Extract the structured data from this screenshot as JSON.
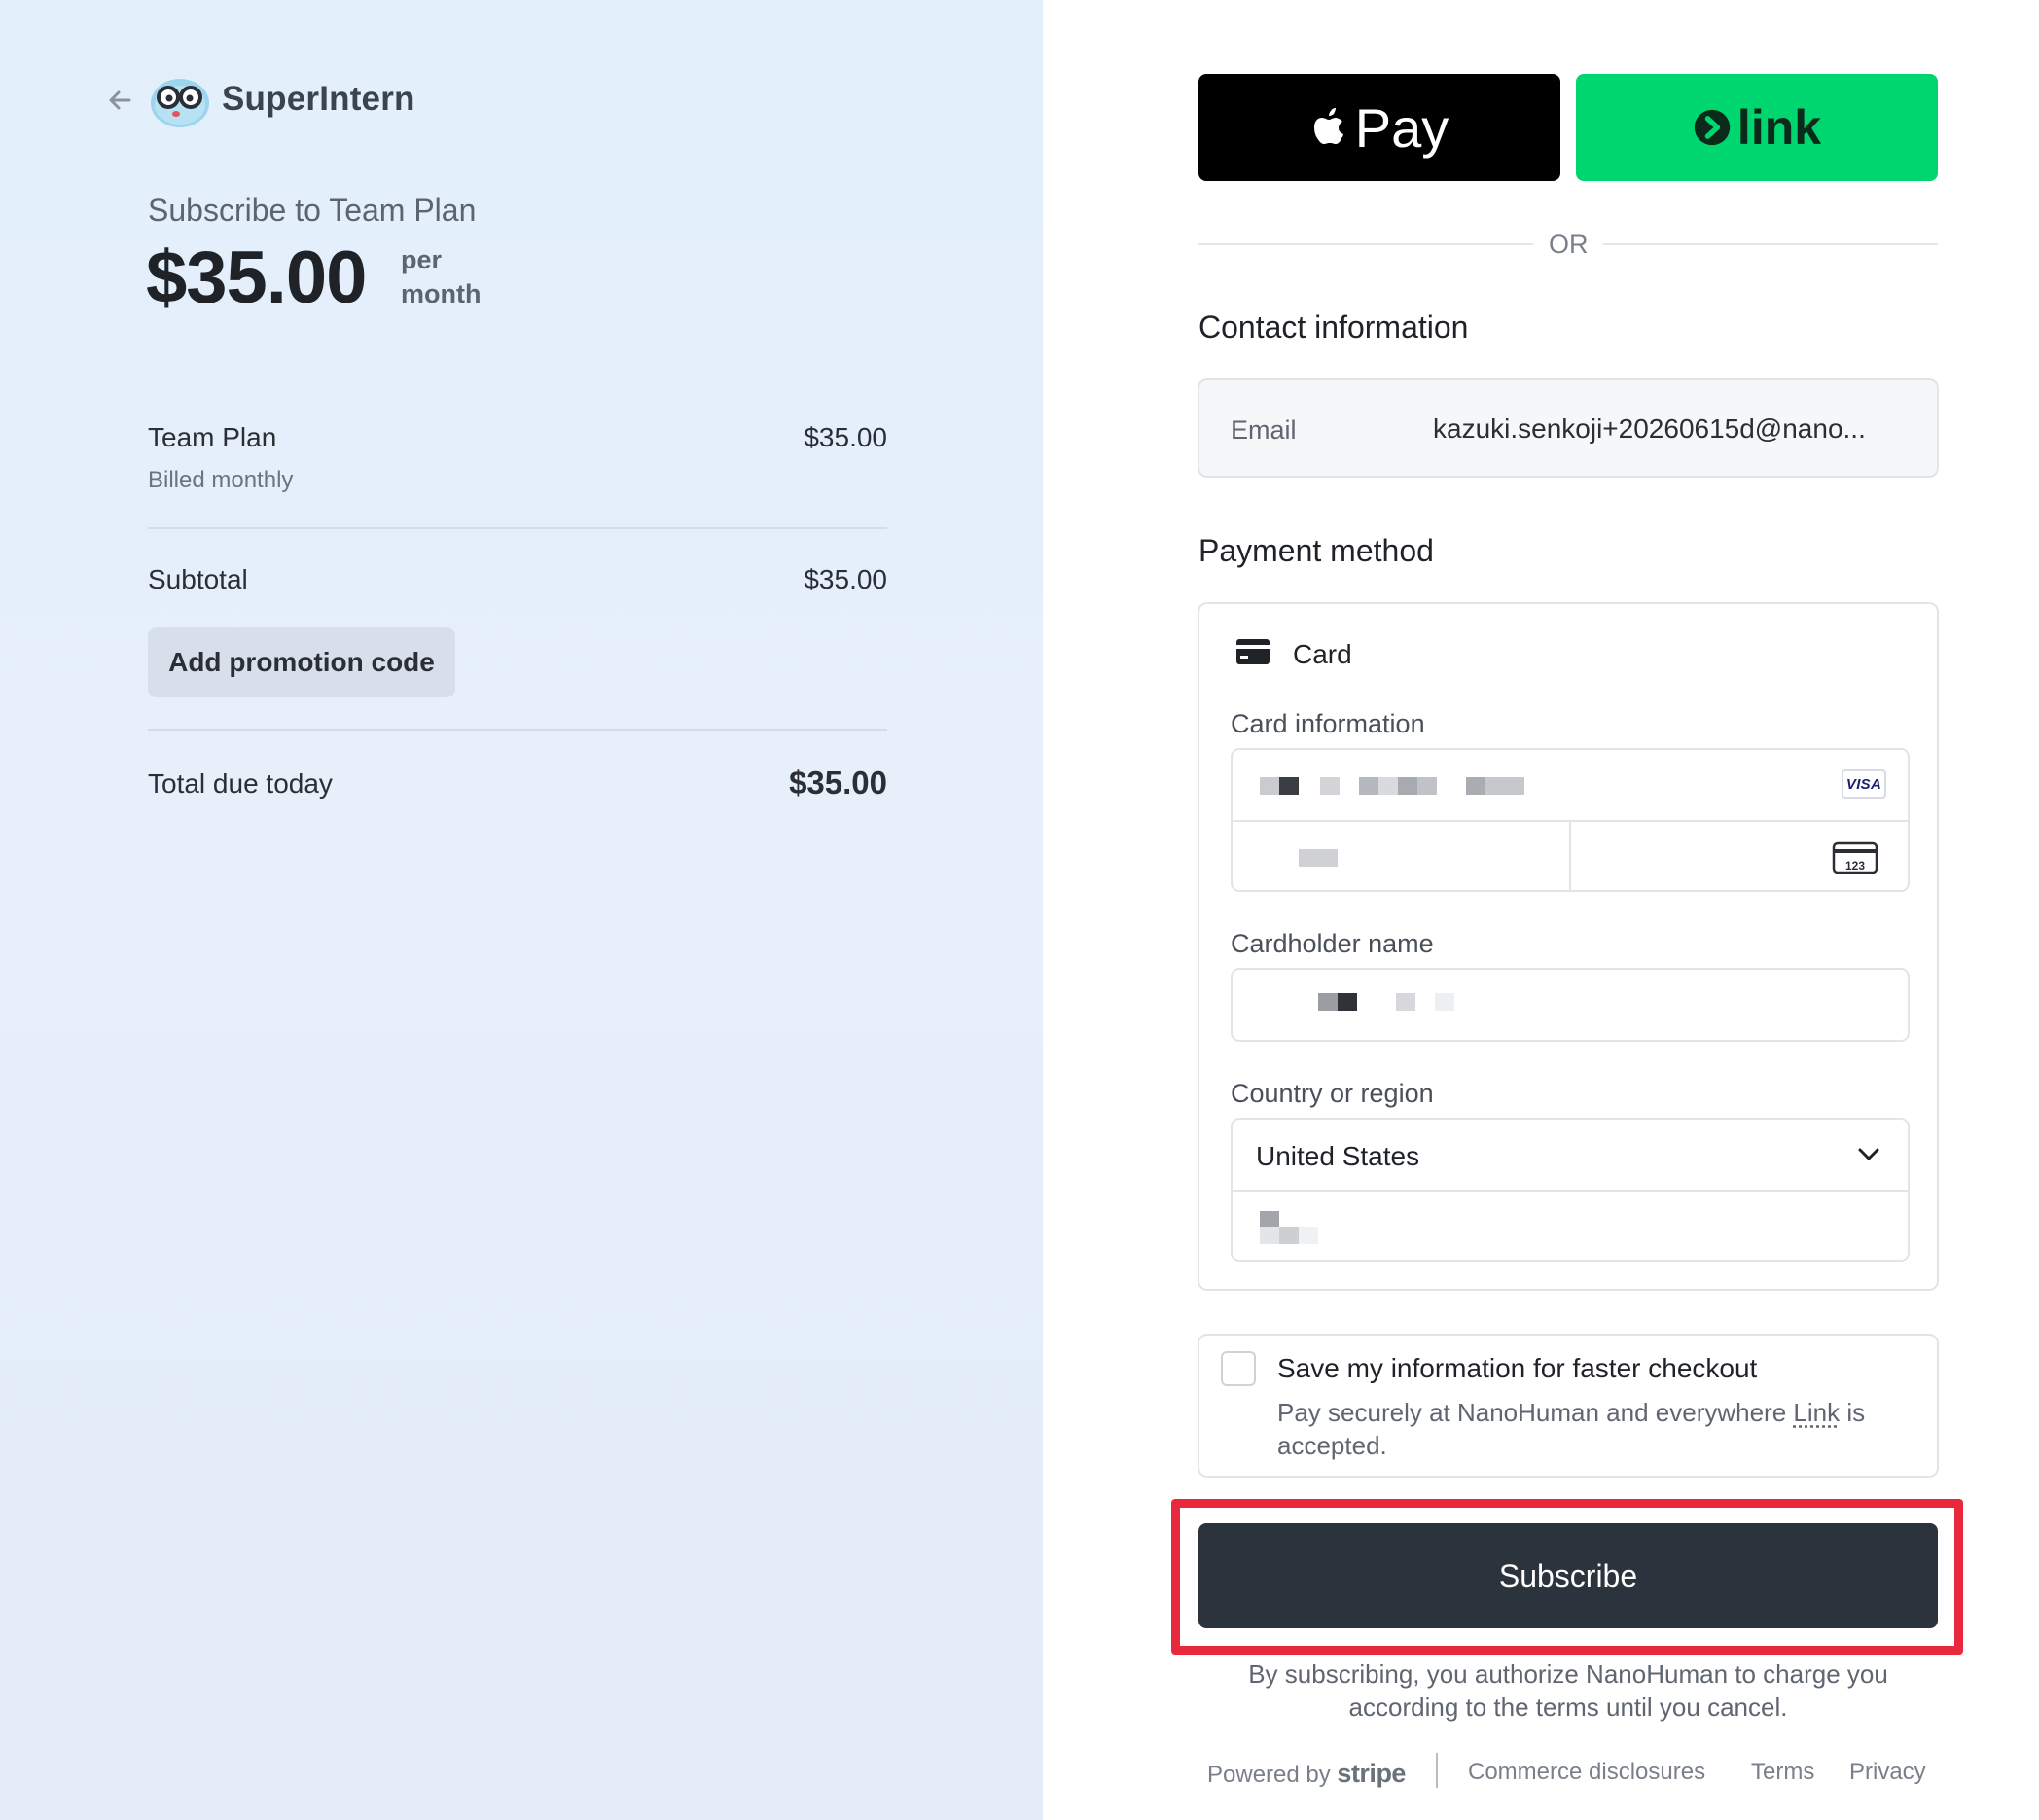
{
  "brand": {
    "name": "SuperIntern"
  },
  "summary": {
    "title": "Subscribe to Team Plan",
    "price": "$35.00",
    "per_line1": "per",
    "per_line2": "month",
    "item_name": "Team Plan",
    "item_billing": "Billed monthly",
    "item_price": "$35.00",
    "subtotal_label": "Subtotal",
    "subtotal_value": "$35.00",
    "promo_label": "Add promotion code",
    "total_label": "Total due today",
    "total_value": "$35.00"
  },
  "express": {
    "apple_pay_label": "Pay",
    "link_label": "link",
    "or_label": "OR"
  },
  "contact": {
    "title": "Contact information",
    "email_label": "Email",
    "email_value": "kazuki.senkoji+20260615d@nano..."
  },
  "payment": {
    "title": "Payment method",
    "method_label": "Card",
    "card_info_label": "Card information",
    "card_brand": "VISA",
    "cvc_icon_text": "123",
    "cardholder_label": "Cardholder name",
    "country_label": "Country or region",
    "country_value": "United States"
  },
  "save": {
    "title": "Save my information for faster checkout",
    "desc_before": "Pay securely at NanoHuman and everywhere ",
    "desc_link": "Link",
    "desc_after": " is accepted."
  },
  "subscribe": {
    "button_label": "Subscribe",
    "consent": "By subscribing, you authorize NanoHuman to charge you according to the terms until you cancel."
  },
  "footer": {
    "powered_by": "Powered by",
    "stripe": "stripe",
    "links": [
      "Commerce disclosures",
      "Terms",
      "Privacy"
    ]
  },
  "colors": {
    "left_bg": "#e4effc",
    "apple_pay_bg": "#000000",
    "link_bg": "#00d66f",
    "subscribe_bg": "#2b343c",
    "highlight": "#e8283c"
  },
  "icons": {
    "back": "arrow-left-icon",
    "logo": "superintern-logo",
    "apple": "apple-icon",
    "link": "link-arrow-icon",
    "card": "credit-card-icon",
    "cvc": "cvc-card-icon",
    "chevron": "chevron-down-icon"
  }
}
